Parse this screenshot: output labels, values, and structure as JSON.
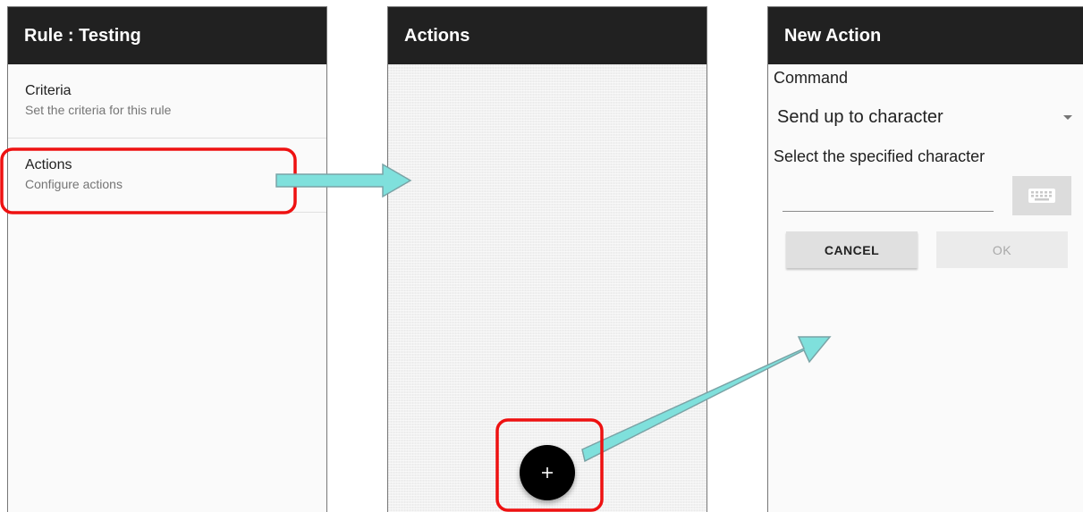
{
  "screen1": {
    "title": "Rule : Testing",
    "items": [
      {
        "title": "Criteria",
        "subtitle": "Set the criteria for this rule"
      },
      {
        "title": "Actions",
        "subtitle": "Configure actions"
      }
    ]
  },
  "screen2": {
    "title": "Actions",
    "fab_icon": "plus-icon"
  },
  "screen3": {
    "title": "New Action",
    "command_label": "Command",
    "command_value": "Send up to character",
    "char_label": "Select the specified character",
    "char_value": "",
    "keyboard_icon": "keyboard-icon",
    "cancel_label": "CANCEL",
    "ok_label": "OK"
  },
  "colors": {
    "appbar": "#212121",
    "highlight": "#ee1111",
    "arrow": "#7fe0dc",
    "fab": "#000000"
  }
}
